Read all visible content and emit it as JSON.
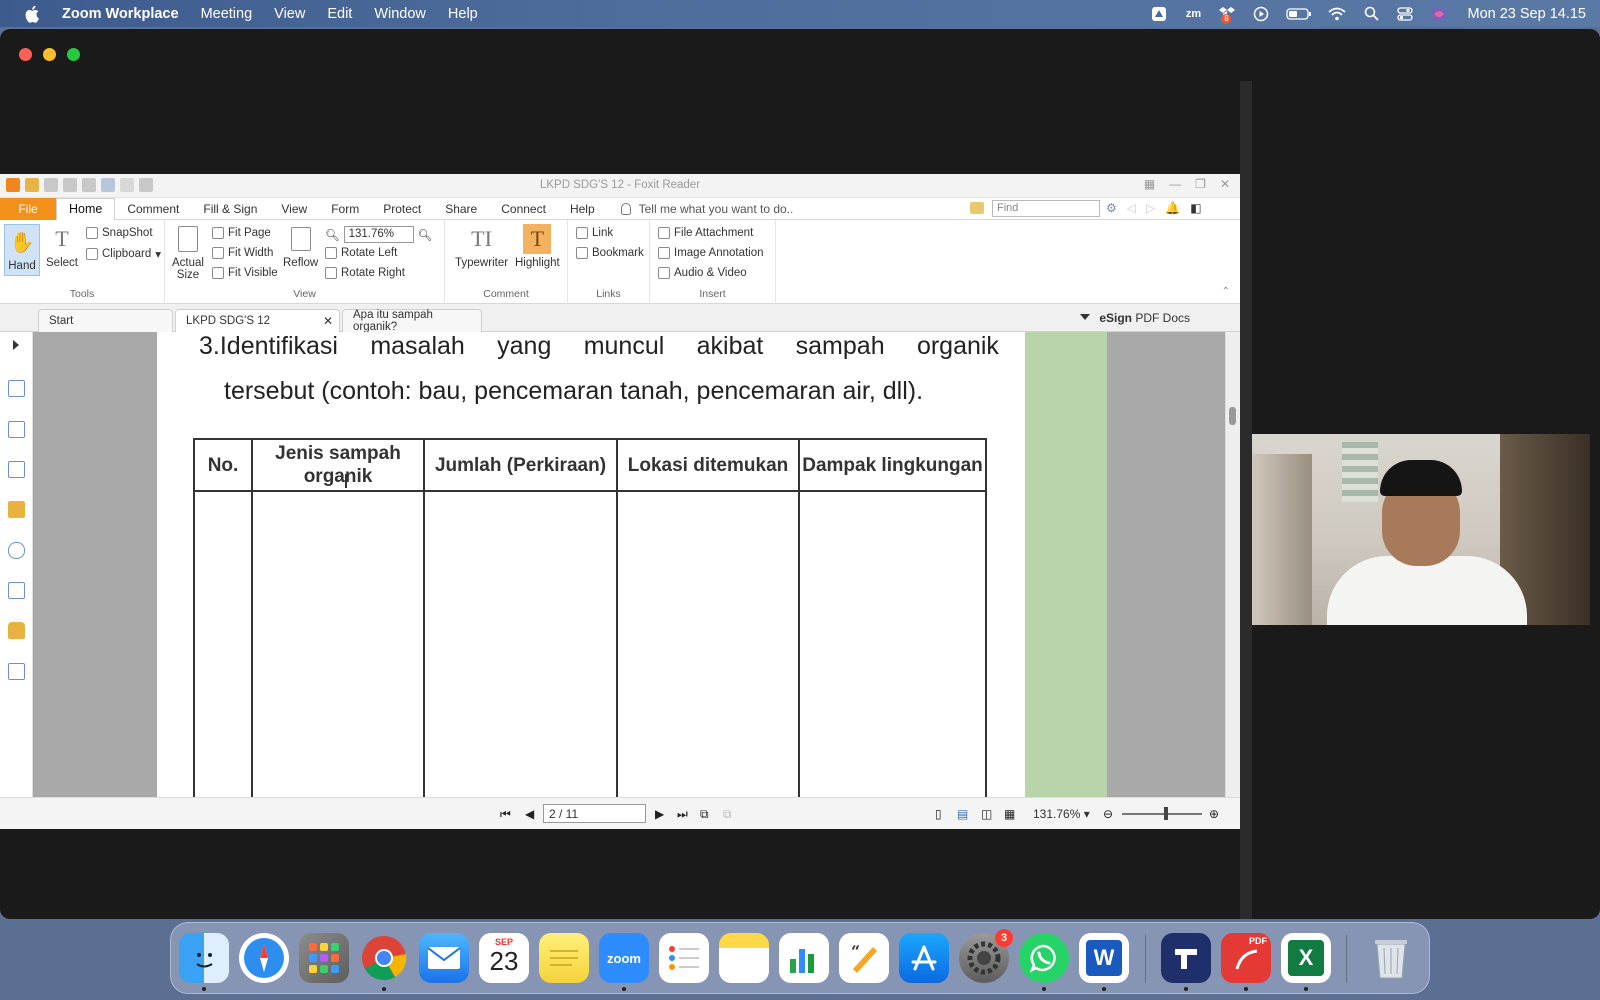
{
  "menubar": {
    "items": [
      "Zoom Workplace",
      "Meeting",
      "View",
      "Edit",
      "Window",
      "Help"
    ],
    "clock": "Mon 23 Sep  14.15",
    "zoom_icon_label": "zm",
    "dropbox_badge": "8"
  },
  "foxit": {
    "window_title": "LKPD SDG'S 12 - Foxit Reader",
    "menu_tabs": [
      "File",
      "Home",
      "Comment",
      "Fill & Sign",
      "View",
      "Form",
      "Protect",
      "Share",
      "Connect",
      "Help"
    ],
    "tell_me": "Tell me what you want to do..",
    "find_placeholder": "Find",
    "ribbon": {
      "hand": "Hand",
      "select": "Select",
      "snapshot": "SnapShot",
      "clipboard": "Clipboard",
      "tools_label": "Tools",
      "actual_size_1": "Actual",
      "actual_size_2": "Size",
      "fit_page": "Fit Page",
      "fit_width": "Fit Width",
      "fit_visible": "Fit Visible",
      "reflow": "Reflow",
      "zoom_value": "131.76%",
      "rotate_left": "Rotate Left",
      "rotate_right": "Rotate Right",
      "view_label": "View",
      "typewriter": "Typewriter",
      "highlight": "Highlight",
      "comment_label": "Comment",
      "link": "Link",
      "bookmark": "Bookmark",
      "links_label": "Links",
      "file_attachment": "File Attachment",
      "image_annotation": "Image Annotation",
      "audio_video": "Audio & Video",
      "insert_label": "Insert"
    },
    "doc_tabs": [
      "Start",
      "LKPD SDG'S 12",
      "Apa itu sampah organik?"
    ],
    "esign_bold": "eSign",
    "esign_rest": " PDF Docs",
    "page_content": {
      "q_number": "3.",
      "q_line1_words": [
        "Identifikasi",
        "masalah",
        "yang",
        "muncul",
        "akibat",
        "sampah",
        "organik"
      ],
      "q_line2": "tersebut (contoh: bau, pencemaran tanah, pencemaran air, dll).",
      "table_headers": [
        "No.",
        "Jenis sampah organik",
        "Jumlah (Perkiraan)",
        "Lokasi ditemukan",
        "Dampak lingkungan"
      ]
    },
    "status": {
      "page_indicator": "2 / 11",
      "zoom": "131.76%"
    }
  },
  "dock": {
    "calendar_month": "SEP",
    "calendar_day": "23",
    "zoom_label": "zoom",
    "settings_badge": "3",
    "pdf_label": "PDF"
  }
}
